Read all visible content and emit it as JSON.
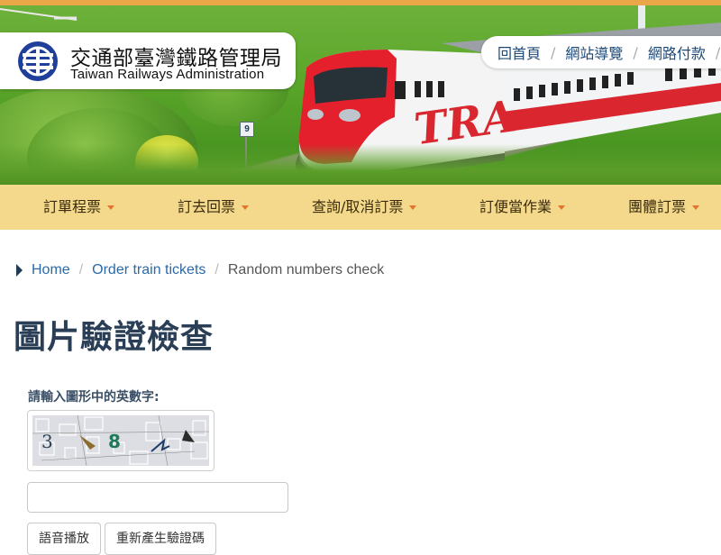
{
  "header": {
    "logo_cn": "交通部臺灣鐵路管理局",
    "logo_en": "Taiwan Railways Administration",
    "sign_number": "9",
    "train_text": "TRA",
    "top_links": [
      "回首頁",
      "網站導覽",
      "網路付款"
    ],
    "top_link_separator": "/"
  },
  "nav": {
    "items": [
      "訂單程票",
      "訂去回票",
      "查詢/取消訂票",
      "訂便當作業",
      "團體訂票"
    ]
  },
  "breadcrumb": {
    "items": [
      "Home",
      "Order train tickets",
      "Random numbers check"
    ],
    "separator": "/"
  },
  "page": {
    "title": "圖片驗證檢查",
    "captcha_label": "請輸入圖形中的英數字:",
    "captcha_input_value": "",
    "buttons": [
      "語音播放",
      "重新產生驗證碼"
    ]
  },
  "colors": {
    "nav_bg": "#f4d98c",
    "nav_caret": "#e2742e",
    "link": "#2a6aa8",
    "title": "#2a3e55",
    "topbar": "#e9a74a"
  }
}
